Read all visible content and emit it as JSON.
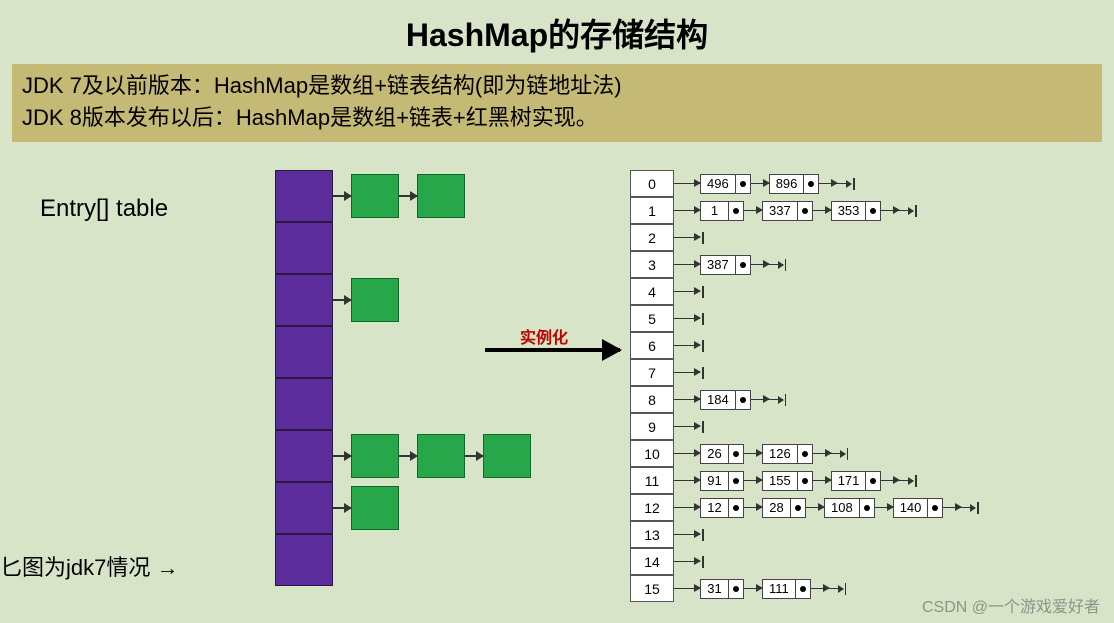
{
  "title": "HashMap的存储结构",
  "desc_line1": "JDK 7及以前版本：HashMap是数组+链表结构(即为链地址法)",
  "desc_line2": "JDK 8版本发布以后：HashMap是数组+链表+红黑树实现。",
  "label_entry": "Entry[] table",
  "label_jdk7": "匕图为jdk7情况 →",
  "inst_label": "实例化",
  "watermark": "CSDN @一个游戏爱好者",
  "left_array_size": 8,
  "left_chains": [
    {
      "slot": 0,
      "count": 2
    },
    {
      "slot": 2,
      "count": 1
    },
    {
      "slot": 5,
      "count": 3
    },
    {
      "slot": 6,
      "count": 1
    }
  ],
  "hash_indices": [
    0,
    1,
    2,
    3,
    4,
    5,
    6,
    7,
    8,
    9,
    10,
    11,
    12,
    13,
    14,
    15
  ],
  "hash_rows": {
    "0": [
      496,
      896
    ],
    "1": [
      1,
      337,
      353
    ],
    "2": [],
    "3": [
      387
    ],
    "4": [],
    "5": [],
    "6": [],
    "7": [],
    "8": [
      184
    ],
    "9": [],
    "10": [
      26,
      126
    ],
    "11": [
      91,
      155,
      171
    ],
    "12": [
      12,
      28,
      108,
      140
    ],
    "13": [],
    "14": [],
    "15": [
      31,
      111
    ]
  }
}
